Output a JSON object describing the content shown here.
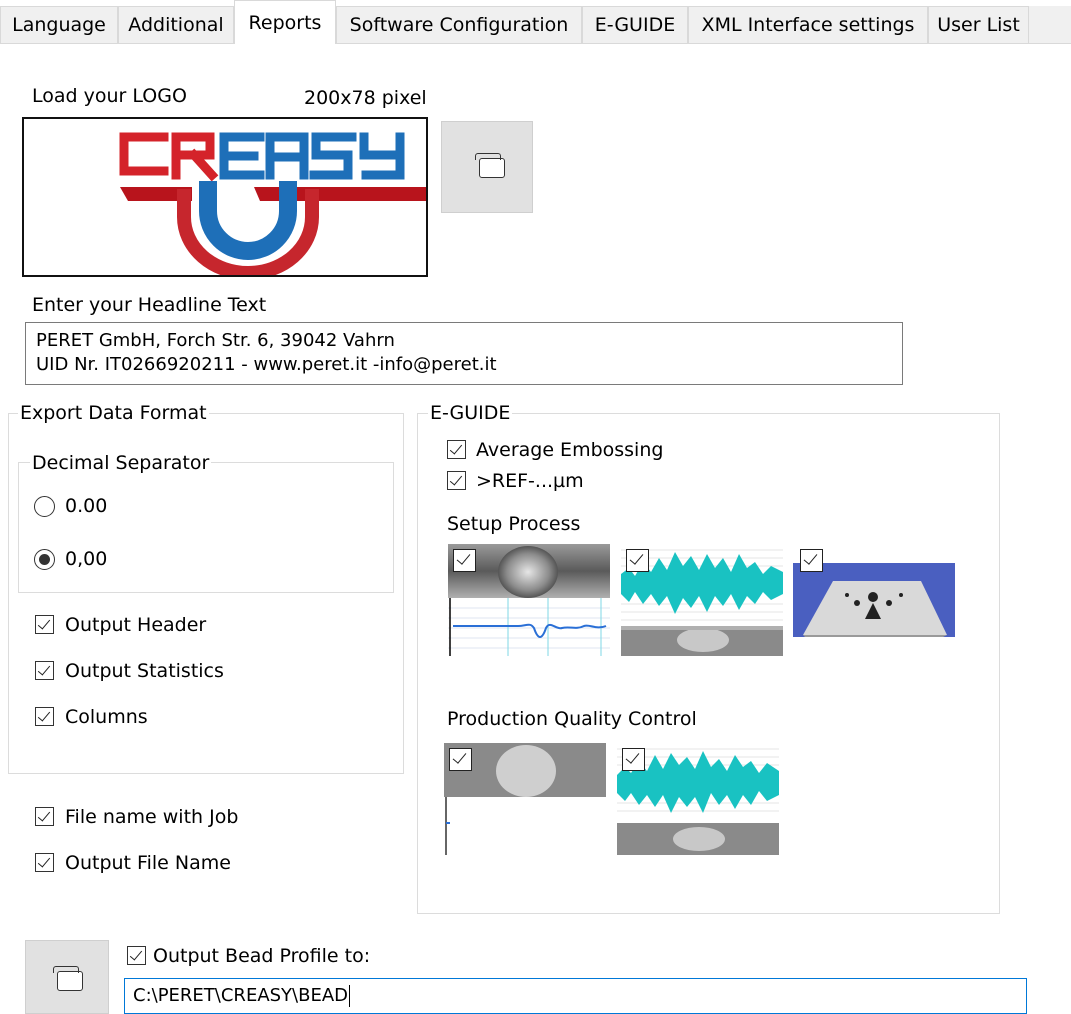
{
  "tabs": [
    {
      "label": "Language"
    },
    {
      "label": "Additional"
    },
    {
      "label": "Reports",
      "active": true
    },
    {
      "label": "Software Configuration"
    },
    {
      "label": "E-GUIDE"
    },
    {
      "label": "XML Interface settings"
    },
    {
      "label": "User List"
    }
  ],
  "logo": {
    "title": "Load your LOGO",
    "size_hint": "200x78 pixel",
    "image_text": "CREASY",
    "colors": {
      "red": "#d4232a",
      "blue": "#1e6fb8"
    },
    "browse_icon": "folder-icon"
  },
  "headline": {
    "label": "Enter your Headline Text",
    "line1": "PERET GmbH, Forch Str. 6, 39042 Vahrn",
    "line2": "UID Nr. IT0266920211 - www.peret.it -info@peret.it"
  },
  "export": {
    "legend": "Export Data Format",
    "decimal": {
      "legend": "Decimal Separator",
      "options": [
        {
          "label": "0.00",
          "selected": false
        },
        {
          "label": "0,00",
          "selected": true
        }
      ]
    },
    "checks": [
      {
        "label": "Output Header",
        "checked": true
      },
      {
        "label": "Output Statistics",
        "checked": true
      },
      {
        "label": "Columns",
        "checked": true
      }
    ]
  },
  "file_options": [
    {
      "label": "File name with Job",
      "checked": true
    },
    {
      "label": "Output File Name",
      "checked": true
    }
  ],
  "eguide": {
    "legend": "E-GUIDE",
    "checks": [
      {
        "label": "Average Embossing",
        "checked": true
      },
      {
        "label": ">REF-...µm",
        "checked": true
      }
    ],
    "setup_process": {
      "label": "Setup Process",
      "thumbnails": 3
    },
    "production_qc": {
      "label": "Production Quality Control",
      "thumbnails": 2
    },
    "colors": {
      "teal": "#19c2c2",
      "blue_plot": "#2a6fd6",
      "plate_blue": "#4a5fc0"
    }
  },
  "bead": {
    "label": "Output Bead Profile to:",
    "checked": true,
    "path": "C:\\PERET\\CREASY\\BEAD",
    "browse_icon": "folder-icon"
  }
}
